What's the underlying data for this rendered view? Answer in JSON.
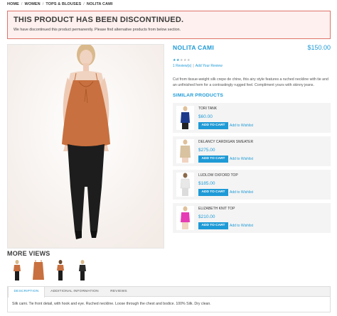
{
  "breadcrumb": {
    "home": "HOME",
    "women": "WOMEN",
    "category": "TOPS & BLOUSES",
    "current": "NOLITA CAMI",
    "separator": "/"
  },
  "notice": {
    "title": "THIS PRODUCT HAS BEEN DISCONTINUED.",
    "text": "We have discontinued this product permanently. Please find alternative products from below section."
  },
  "product": {
    "name": "NOLITA CAMI",
    "price": "$150.00",
    "rating_stars": 2,
    "rating_max": 5,
    "reviews_link": "1 Review(s)",
    "add_review_link": "Add Your Review",
    "review_divider": "|",
    "description": "Cut from tissue-weight silk crepe de chine, this airy style features a ruched neckline with tie and an unfinished hem for a contrastingly rugged feel. Compliment yours with skinny jeans."
  },
  "similar": {
    "heading": "SIMILAR PRODUCTS",
    "cart_label": "ADD TO CART",
    "wishlist_label": "Add to Wishlist",
    "items": [
      {
        "name": "TORI TANK",
        "price": "$60.00",
        "color": "#1d3a8a"
      },
      {
        "name": "DELANCY CARDIGAN SWEATER",
        "price": "$275.00",
        "color": "#d8c2a0"
      },
      {
        "name": "LUDLOW OXFORD TOP",
        "price": "$185.00",
        "color": "#e8e8e8"
      },
      {
        "name": "ELIZABETH KNIT TOP",
        "price": "$210.00",
        "color": "#e53bb4"
      }
    ]
  },
  "more_views": {
    "heading": "MORE VIEWS",
    "count": 4
  },
  "tabs": {
    "items": [
      "DESCRIPTION",
      "ADDITIONAL INFORMATION",
      "REVIEWS"
    ],
    "active": 0,
    "content": "Silk cami. Tie front detail, with hook and eye. Ruched neckline. Loose through the chest and bodice. 100% Silk. Dry clean."
  },
  "colors": {
    "accent": "#1e9ad6",
    "notice_border": "#e0736a",
    "notice_bg": "#fdf0ee",
    "cami": "#c8703f"
  }
}
